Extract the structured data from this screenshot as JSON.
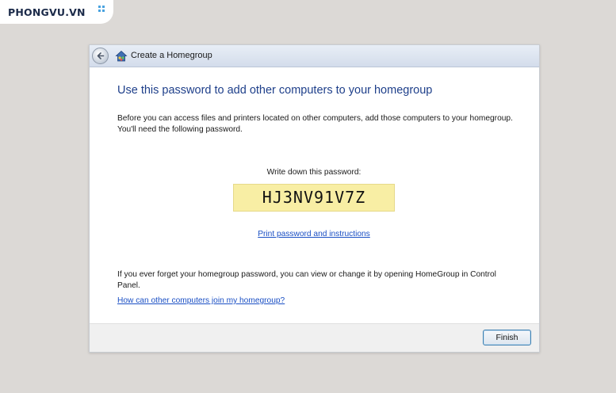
{
  "watermark": {
    "text": "PHONGVU.VN",
    "icon": "dots-icon",
    "color": "#1b2a49",
    "accent": "#4aa3df"
  },
  "window": {
    "title": "Create a Homegroup",
    "back_icon": "back-arrow-icon",
    "app_icon": "homegroup-icon",
    "heading": "Use this password to add other computers to your homegroup",
    "intro": "Before you can access files and printers located on other computers, add those computers to your homegroup. You'll need the following password.",
    "password_label": "Write down this password:",
    "password": "HJ3NV91V7Z",
    "print_link": "Print password and instructions",
    "forget_text": "If you ever forget your homegroup password, you can view or change it by opening HomeGroup in Control Panel.",
    "join_link": "How can other computers join my homegroup?",
    "finish_label": "Finish"
  },
  "colors": {
    "heading": "#1e3f8a",
    "link": "#1a4fc4",
    "password_bg": "#f8eea4",
    "page_bg": "#dcd9d6"
  }
}
